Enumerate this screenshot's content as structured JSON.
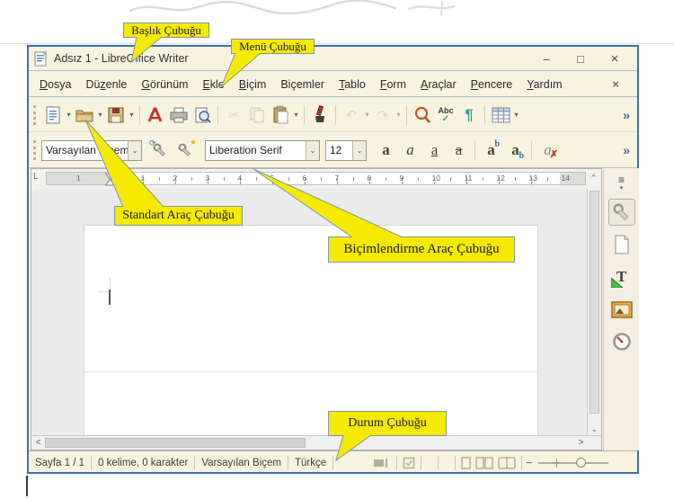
{
  "window": {
    "title": "Adsız 1 - LibreOffice Writer",
    "minimize_glyph": "–",
    "maximize_glyph": "□",
    "close_glyph": "×",
    "doc_close_glyph": "×"
  },
  "menu": {
    "items": [
      {
        "label": "Dosya",
        "accel": 0
      },
      {
        "label": "Düzenle",
        "accel": 2
      },
      {
        "label": "Görünüm",
        "accel": 0
      },
      {
        "label": "Ekle",
        "accel": 0
      },
      {
        "label": "Biçim",
        "accel": 0
      },
      {
        "label": "Biçemler",
        "accel": -1
      },
      {
        "label": "Tablo",
        "accel": 0
      },
      {
        "label": "Form",
        "accel": 0
      },
      {
        "label": "Araçlar",
        "accel": 0
      },
      {
        "label": "Pencere",
        "accel": 0
      },
      {
        "label": "Yardım",
        "accel": 0
      }
    ]
  },
  "standard_toolbar": {
    "cut_glyph": "✂",
    "undo_glyph": "↶",
    "redo_glyph": "↷",
    "spell_label": "Abc",
    "spell_check": "✓",
    "pilcrow_glyph": "¶",
    "overflow_glyph": "»"
  },
  "formatting_toolbar": {
    "paragraph_style": "Varsayılan Biçem",
    "font_name": "Liberation Serif",
    "font_size": "12",
    "update_style_glyph": "⟳",
    "new_style_glyph": "★",
    "bold_glyph": "a",
    "italic_glyph": "a",
    "underline_glyph": "a",
    "strike_glyph": "a",
    "sup_main": "a",
    "sup_small": "b",
    "sub_main": "a",
    "sub_small": "b",
    "clear_main": "a",
    "clear_x": "✗",
    "overflow_glyph": "»"
  },
  "ruler": {
    "corner": "L",
    "margin_number": "1",
    "numbers": [
      "1",
      "2",
      "3",
      "4",
      "5",
      "6",
      "7",
      "8",
      "9",
      "10",
      "11",
      "12",
      "13",
      "14"
    ]
  },
  "scroll": {
    "up": "^",
    "down": "⌄",
    "left": "<",
    "right": ">"
  },
  "sidebar": {
    "settings_glyph": "≡",
    "settings_caret": "▾",
    "styles_glyph": "T"
  },
  "status_bar": {
    "page": "Sayfa 1 / 1",
    "words": "0 kelime, 0 karakter",
    "style": "Varsayılan Biçem",
    "language": "Türkçe",
    "zoom_minus": "−"
  },
  "callouts": {
    "title_bar": "Başlık Çubuğu",
    "menu_bar": "Menü Çubuğu",
    "standard_toolbar": "Standart Araç Çubuğu",
    "formatting_toolbar": "Biçimlendirme Araç Çubuğu",
    "status_bar": "Durum Çubuğu"
  },
  "colors": {
    "window_bg": "#f7f3de",
    "window_border": "#3e6fa6",
    "callout_fill": "#f6ea00",
    "callout_border": "#7d97a8",
    "pilcrow_teal": "#3a9ca6",
    "spell_green": "#3fae49",
    "pdf_red": "#c3392f",
    "accent_blue": "#2f6bb0"
  }
}
